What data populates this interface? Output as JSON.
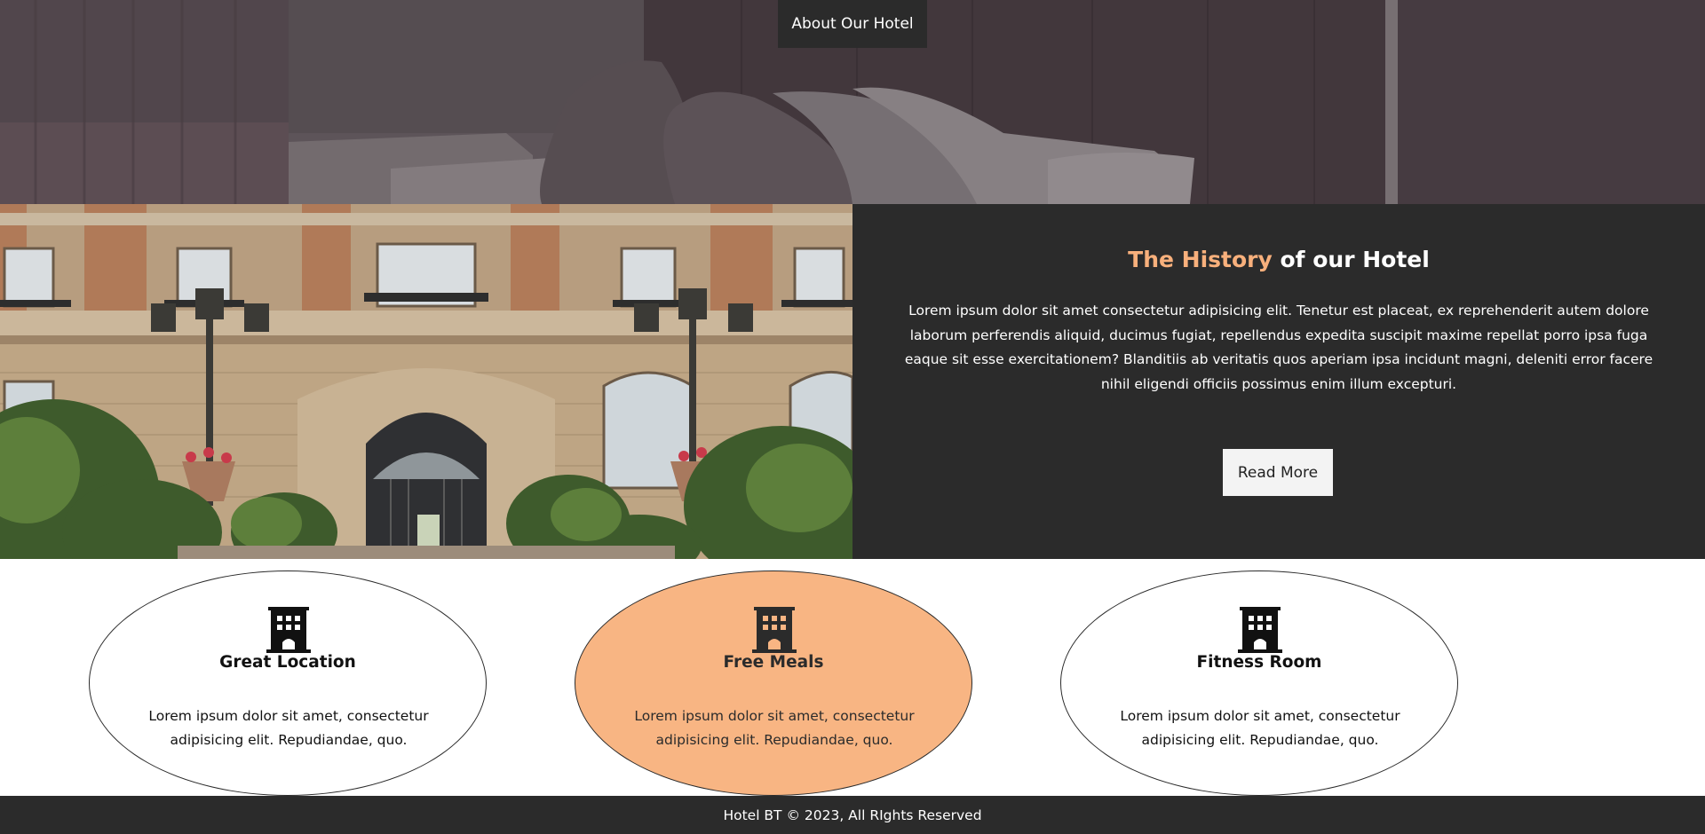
{
  "hero": {
    "button_label": "About Our Hotel"
  },
  "history": {
    "title_accent": "The History",
    "title_rest": " of our Hotel",
    "paragraph": "Lorem ipsum dolor sit amet consectetur adipisicing elit. Tenetur est placeat, ex reprehenderit autem dolore laborum perferendis aliquid, ducimus fugiat, repellendus expedita suscipit maxime repellat porro ipsa fuga eaque sit esse exercitationem? Blanditiis ab veritatis quos aperiam ipsa incidunt magni, deleniti error facere nihil eligendi officiis possimus enim illum excepturi.",
    "button_label": "Read More",
    "accent_color": "#f8b07c"
  },
  "features": [
    {
      "icon": "building-icon",
      "title": "Great Location",
      "description": "Lorem ipsum dolor sit amet, consectetur adipisicing elit. Repudiandae, quo."
    },
    {
      "icon": "building-icon",
      "title": "Free Meals",
      "description": "Lorem ipsum dolor sit amet, consectetur adipisicing elit. Repudiandae, quo.",
      "highlight_color": "#f8b583"
    },
    {
      "icon": "building-icon",
      "title": "Fitness Room",
      "description": "Lorem ipsum dolor sit amet, consectetur adipisicing elit. Repudiandae, quo."
    }
  ],
  "footer": {
    "text": "Hotel BT © 2023, All RIghts Reserved"
  }
}
